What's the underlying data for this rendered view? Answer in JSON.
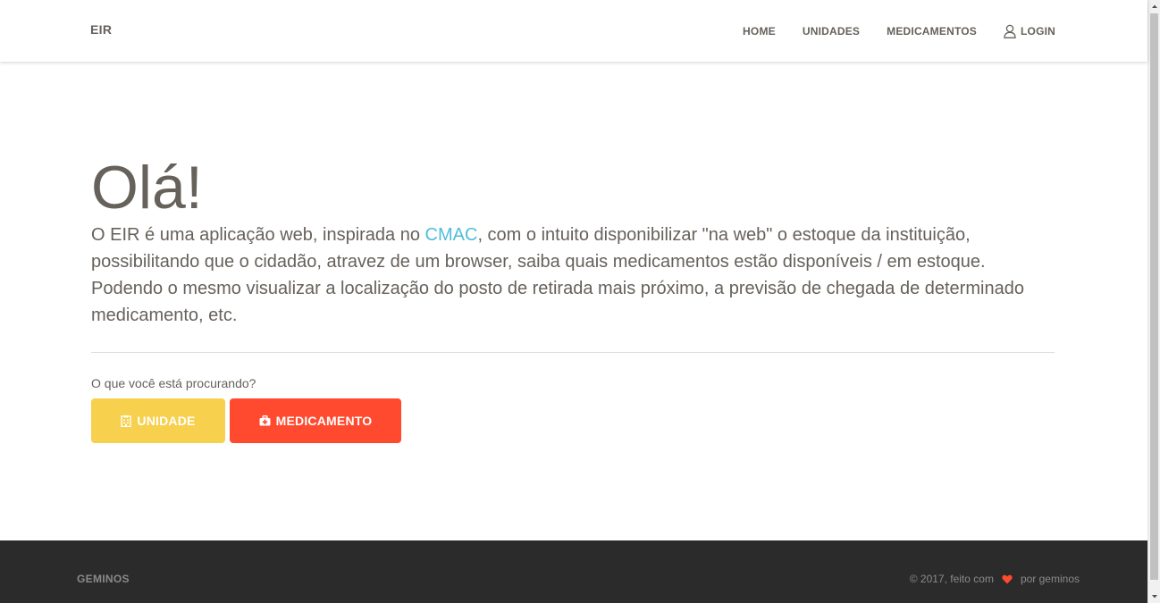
{
  "navbar": {
    "brand": "EIR",
    "links": [
      {
        "label": "HOME"
      },
      {
        "label": "UNIDADES"
      },
      {
        "label": "MEDICAMENTOS"
      }
    ],
    "login_label": "LOGIN",
    "login_icon": "user-icon"
  },
  "hero": {
    "title": "Olá!",
    "text_before_link": "O EIR é uma aplicação web, inspirada no ",
    "link_text": "CMAC",
    "text_after_link": ", com o intuito disponibilizar \"na web\" o estoque da instituição, possibilitando que o cidadão, atravez de um browser, saiba quais medicamentos estão disponíveis / em estoque. Podendo o mesmo visualizar a localização do posto de retirada mais próximo, a previsão de chegada de determinado medicamento, etc.",
    "link_color": "#51bcda"
  },
  "search": {
    "question": "O que você está procurando?",
    "unidade_button": {
      "label": "UNIDADE",
      "icon": "hospital-icon",
      "color": "#f7d04e"
    },
    "medicamento_button": {
      "label": "MEDICAMENTO",
      "icon": "medkit-icon",
      "color": "#ff4a2f"
    }
  },
  "footer": {
    "brand": "GEMINOS",
    "credits_before": "© 2017, feito com",
    "heart_icon": "heart-icon",
    "heart_color": "#ff4a2f",
    "credits_after": "por geminos"
  },
  "colors": {
    "text": "#66615b",
    "footer_bg": "#2b2b2b"
  }
}
